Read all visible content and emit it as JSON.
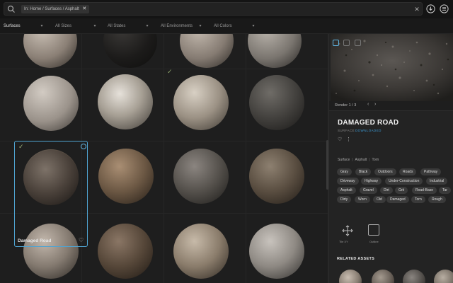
{
  "search": {
    "chip_label": "In: Home / Surfaces / Asphalt",
    "chip_remove": "✕",
    "clear": "✕"
  },
  "filters": [
    {
      "label": "Surfaces",
      "active": true
    },
    {
      "label": "All Sizes",
      "active": false
    },
    {
      "label": "All States",
      "active": false
    },
    {
      "label": "All Environments",
      "active": false
    },
    {
      "label": "All Colors",
      "active": false
    }
  ],
  "grid": {
    "selected": {
      "name": "Damaged Road",
      "check": "✓",
      "fav": "♡"
    },
    "checked_mark": "✓"
  },
  "panel": {
    "render_label": "Render 1 / 3",
    "render_prev": "‹",
    "render_next": "›",
    "title": "DAMAGED ROAD",
    "type": "SURFACE",
    "download_link": "DOWNLOADED",
    "fav": "♡",
    "more": "⋮",
    "breadcrumbs": [
      "Surface",
      "Asphalt",
      "Torn"
    ],
    "tags": [
      "Gray",
      "Black",
      "Outdoors",
      "Roads",
      "Pathway",
      "Driveway",
      "Highway",
      "Under-Construction",
      "Industrial",
      "Asphalt",
      "Gravel",
      "Dirt",
      "Grit",
      "Road-Base",
      "Tar",
      "Dirty",
      "Worn",
      "Old",
      "Damaged",
      "Torn",
      "Rough"
    ],
    "tile_label": "Tile XY",
    "outline_label": "Outline",
    "related_title": "RELATED ASSETS"
  },
  "colors": {
    "accent": "#3c9bd6",
    "selection_border": "#4fa3d1",
    "check": "#9cb07a"
  }
}
